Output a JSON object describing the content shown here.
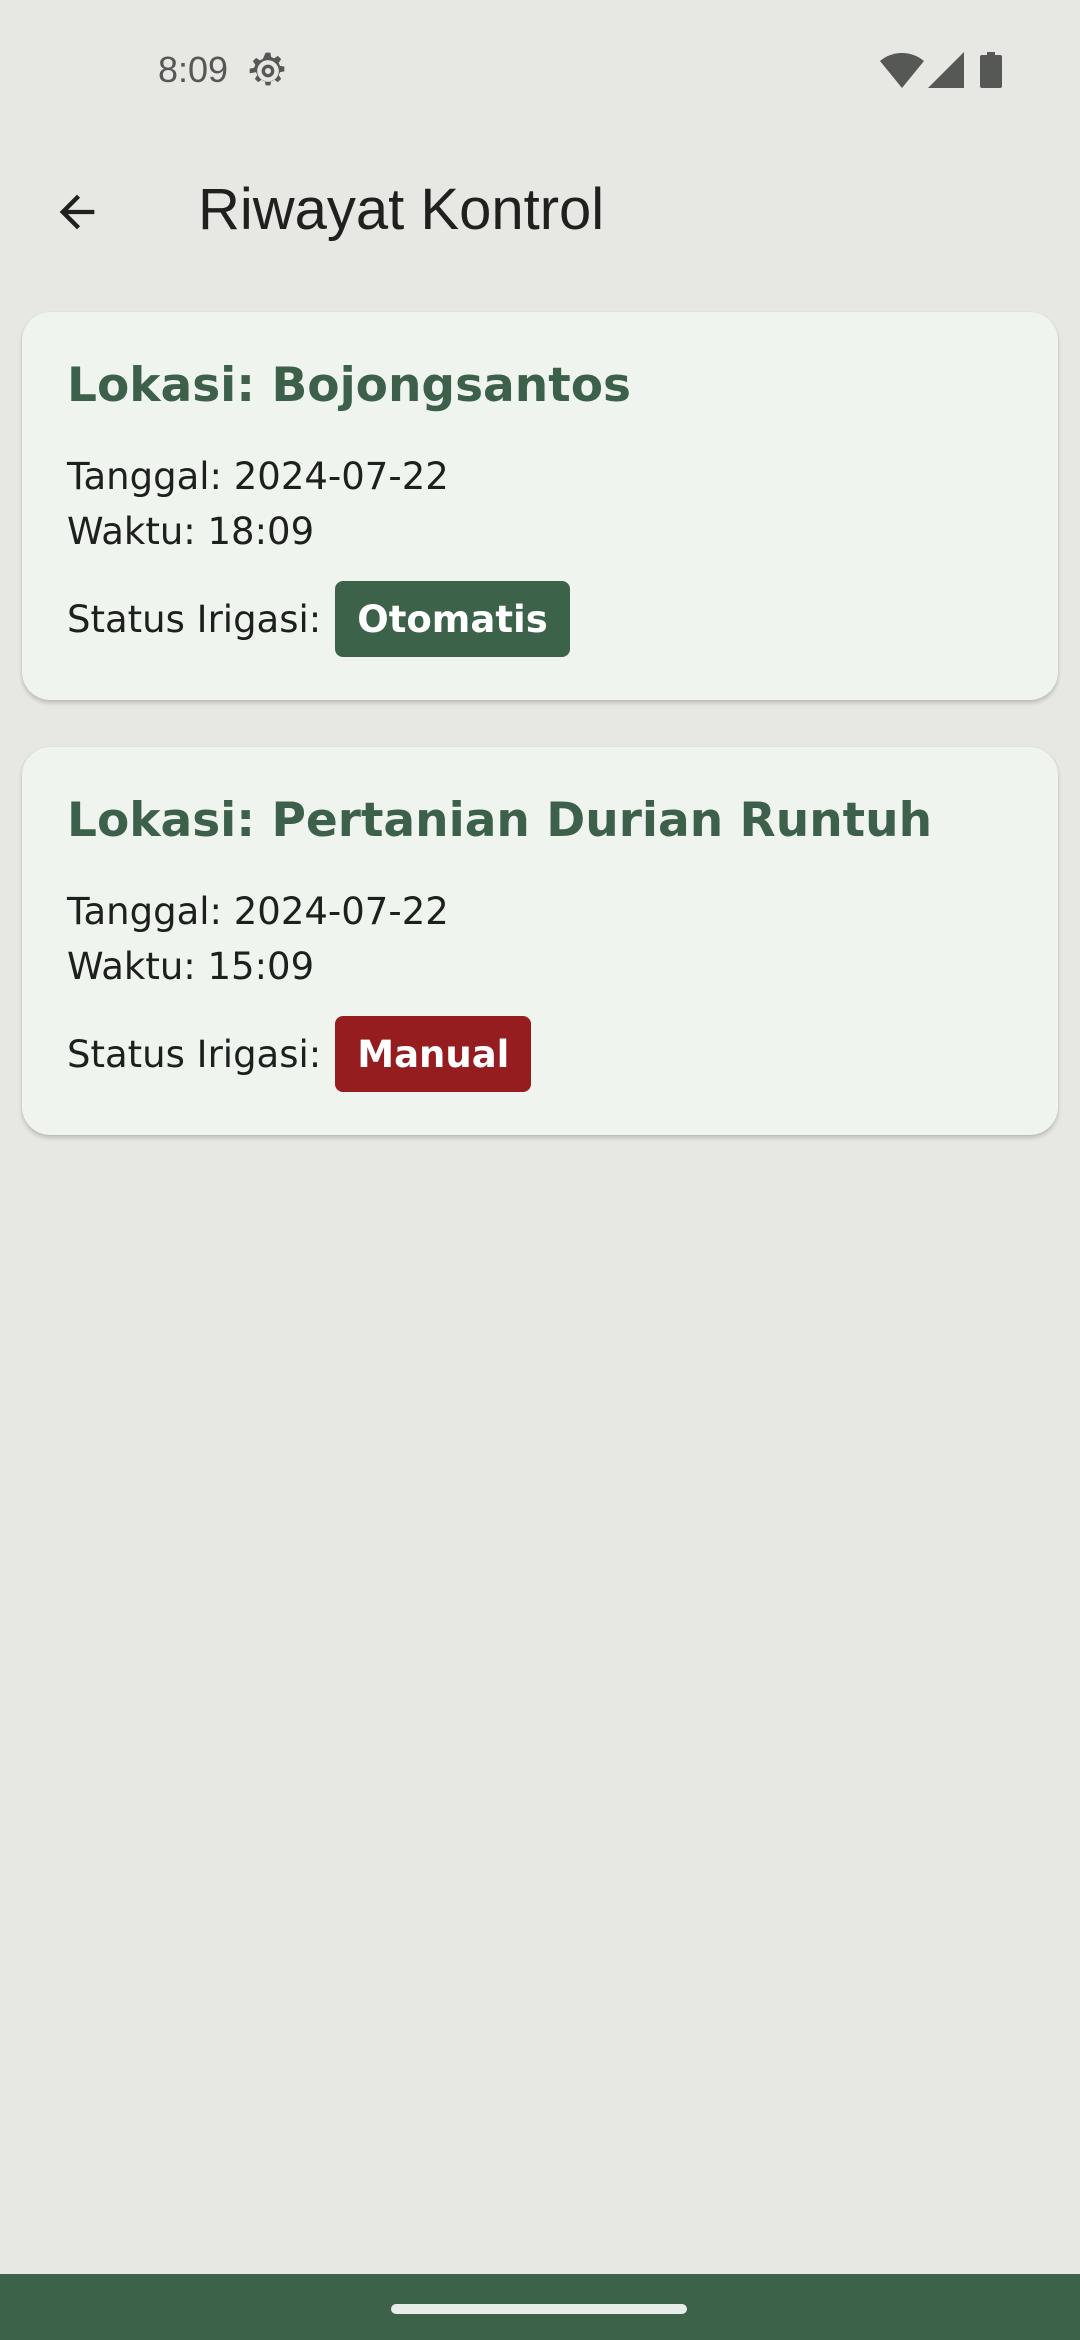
{
  "status_bar": {
    "time": "8:09",
    "icons": [
      "gear-icon",
      "wifi-icon",
      "signal-icon",
      "battery-icon"
    ]
  },
  "app_bar": {
    "back_icon": "arrow-back-icon",
    "title": "Riwayat Kontrol"
  },
  "records": [
    {
      "location": "Lokasi: Bojongsantos",
      "date": "Tanggal: 2024-07-22",
      "time": "Waktu: 18:09",
      "status_label": "Status Irigasi:",
      "status": "Otomatis",
      "status_color": "#3d624a"
    },
    {
      "location": "Lokasi: Pertanian Durian Runtuh",
      "date": "Tanggal: 2024-07-22",
      "time": "Waktu: 15:09",
      "status_label": "Status Irigasi:",
      "status": "Manual",
      "status_color": "#951c1f"
    }
  ],
  "colors": {
    "background": "#e7e7e3",
    "card": "#eff4ee",
    "accent": "#3d624a",
    "manual": "#951c1f"
  }
}
